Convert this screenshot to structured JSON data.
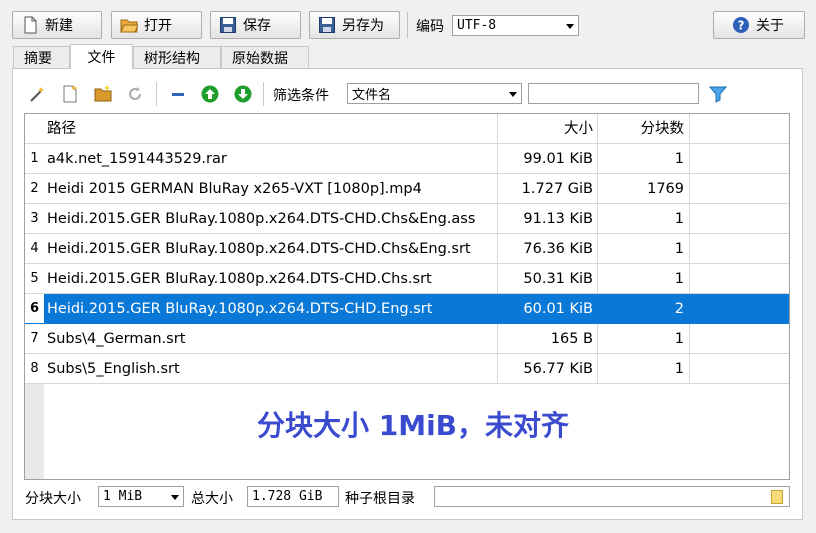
{
  "toolbar": {
    "new_label": "新建",
    "open_label": "打开",
    "save_label": "保存",
    "save_as_label": "另存为",
    "encoding_label": "编码",
    "encoding_value": "UTF-8",
    "about_label": "关于"
  },
  "tabs": [
    {
      "label": "摘要"
    },
    {
      "label": "文件"
    },
    {
      "label": "树形结构"
    },
    {
      "label": "原始数据"
    }
  ],
  "filter": {
    "label": "筛选条件",
    "field_value": "文件名",
    "text_value": ""
  },
  "table": {
    "headers": {
      "path": "路径",
      "size": "大小",
      "blocks": "分块数"
    },
    "rows": [
      {
        "num": "1",
        "path": "a4k.net_1591443529.rar",
        "size": "99.01 KiB",
        "blocks": "1"
      },
      {
        "num": "2",
        "path": "Heidi 2015 GERMAN BluRay x265-VXT [1080p].mp4",
        "size": "1.727 GiB",
        "blocks": "1769"
      },
      {
        "num": "3",
        "path": "Heidi.2015.GER BluRay.1080p.x264.DTS-CHD.Chs&Eng.ass",
        "size": "91.13 KiB",
        "blocks": "1"
      },
      {
        "num": "4",
        "path": "Heidi.2015.GER BluRay.1080p.x264.DTS-CHD.Chs&Eng.srt",
        "size": "76.36 KiB",
        "blocks": "1"
      },
      {
        "num": "5",
        "path": "Heidi.2015.GER BluRay.1080p.x264.DTS-CHD.Chs.srt",
        "size": "50.31 KiB",
        "blocks": "1"
      },
      {
        "num": "6",
        "path": "Heidi.2015.GER BluRay.1080p.x264.DTS-CHD.Eng.srt",
        "size": "60.01 KiB",
        "blocks": "2"
      },
      {
        "num": "7",
        "path": "Subs\\4_German.srt",
        "size": "165 B",
        "blocks": "1"
      },
      {
        "num": "8",
        "path": "Subs\\5_English.srt",
        "size": "56.77 KiB",
        "blocks": "1"
      }
    ],
    "selected_row": 6
  },
  "annotation": "分块大小 1MiB，未对齐",
  "footer": {
    "block_size_label": "分块大小",
    "block_size_value": "1 MiB",
    "total_size_label": "总大小",
    "total_size_value": "1.728 GiB",
    "torrent_root_label": "种子根目录",
    "torrent_root_value": ""
  },
  "colors": {
    "selection": "#0a78d7",
    "annotation": "#3a4bd0",
    "arrow_green": "#1f9e2c",
    "minus_blue": "#2f63b8"
  }
}
